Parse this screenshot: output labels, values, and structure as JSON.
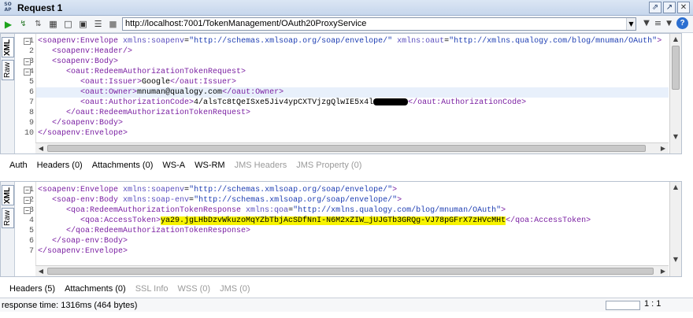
{
  "window": {
    "app_badge": "SO AP",
    "title": "Request 1"
  },
  "toolbar": {
    "url": "http://localhost:7001/TokenManagement/OAuth20ProxyService",
    "help": "?"
  },
  "request_editor": {
    "side_tabs": [
      "XML",
      "Raw"
    ],
    "line_numbers": [
      "1",
      "2",
      "3",
      "4",
      "5",
      "6",
      "7",
      "8",
      "9",
      "10"
    ]
  },
  "request_lines": [
    {
      "t": "tag",
      "s": "<soapenv:Envelope"
    },
    {
      "t": "attr",
      "s": " xmlns:soapenv"
    },
    {
      "t": "txt",
      "s": "="
    },
    {
      "t": "val",
      "s": "\"http://schemas.xmlsoap.org/soap/envelope/\""
    },
    {
      "t": "attr",
      "s": " xmlns:oaut"
    },
    {
      "t": "txt",
      "s": "="
    },
    {
      "t": "val",
      "s": "\"http://xmlns.qualogy.com/blog/mnuman/OAuth\""
    },
    {
      "t": "tag",
      "s": ">"
    }
  ],
  "request_text": [
    "   <soapenv:Header/>",
    "   <soapenv:Body>",
    "      <oaut:RedeemAuthorizationTokenRequest>",
    "         <oaut:Issuer>Google</oaut:Issuer>",
    "         <oaut:Owner>mnuman@qualogy.com</oaut:Owner>",
    "         <oaut:AuthorizationCode>4/alsTc8tQeISxe5Jiv4ypCXTVjzgQlwIE5x4l",
    "</oaut:AuthorizationCode>",
    "      </oaut:RedeemAuthorizationTokenRequest>",
    "   </soapenv:Body>",
    "</soapenv:Envelope>"
  ],
  "request_tabs": [
    {
      "label": "Auth",
      "enabled": true
    },
    {
      "label": "Headers (0)",
      "enabled": true
    },
    {
      "label": "Attachments (0)",
      "enabled": true
    },
    {
      "label": "WS-A",
      "enabled": true
    },
    {
      "label": "WS-RM",
      "enabled": true
    },
    {
      "label": "JMS Headers",
      "enabled": false
    },
    {
      "label": "JMS Property (0)",
      "enabled": false
    }
  ],
  "response_editor": {
    "side_tabs": [
      "XML",
      "Raw"
    ],
    "line_numbers": [
      "1",
      "2",
      "3",
      "4",
      "5",
      "6",
      "7"
    ],
    "line1_open": "<soapenv:Envelope",
    "line1_ns": " xmlns:soapenv",
    "line1_ns_val": "\"http://schemas.xmlsoap.org/soap/envelope/\"",
    "line2_open": "   <soap-env:Body",
    "line2_ns": " xmlns:soap-env",
    "line2_ns_val": "\"http://schemas.xmlsoap.org/soap/envelope/\"",
    "line3_open": "      <qoa:RedeemAuthorizationTokenResponse",
    "line3_ns": " xmlns:qoa",
    "line3_ns_val": "\"http://xmlns.qualogy.com/blog/mnuman/OAuth\"",
    "line4_open": "         <qoa:AccessToken>",
    "line4_token": "ya29.jgLHbDzvWkuzoMqYZbTbjAcSDfNnI-N6M2xZIW_jUJGTb3GRQg-VJ78pGFrX7zHVcMHt",
    "line4_close": "</qoa:AccessToken>",
    "line5": "      </qoa:RedeemAuthorizationTokenResponse>",
    "line6": "   </soap-env:Body>",
    "line7": "</soapenv:Envelope>"
  },
  "response_tabs": [
    {
      "label": "Headers (5)",
      "enabled": true
    },
    {
      "label": "Attachments (0)",
      "enabled": true
    },
    {
      "label": "SSL Info",
      "enabled": false
    },
    {
      "label": "WSS (0)",
      "enabled": false
    },
    {
      "label": "JMS (0)",
      "enabled": false
    }
  ],
  "status": {
    "response_time": "response time: 1316ms (464 bytes)",
    "position": "1 : 1"
  }
}
